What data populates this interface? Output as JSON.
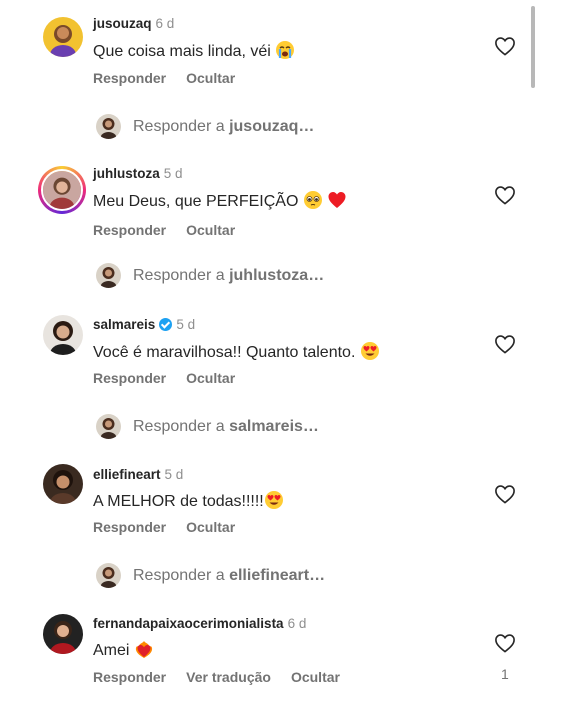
{
  "comments": [
    {
      "username": "jusouzaq",
      "time": "6 d",
      "text": "Que coisa mais linda, véi",
      "actions": [
        "Responder",
        "Ocultar"
      ],
      "reply_user": "jusouzaq…",
      "emoji": "crying-face"
    },
    {
      "username": "juhlustoza",
      "time": "5 d",
      "text": "Meu Deus, que PERFEIÇÃO",
      "actions": [
        "Responder",
        "Ocultar"
      ],
      "reply_user": "juhlustoza…",
      "emoji": "pleading-face-and-heart"
    },
    {
      "username": "salmareis",
      "time": "5 d",
      "text": "Você é maravilhosa!! Quanto talento.",
      "actions": [
        "Responder",
        "Ocultar"
      ],
      "reply_user": "salmareis…",
      "emoji": "heart-eyes",
      "verified": true
    },
    {
      "username": "elliefineart",
      "time": "5 d",
      "text": "A MELHOR de todas!!!!!",
      "actions": [
        "Responder",
        "Ocultar"
      ],
      "reply_user": "elliefineart…",
      "emoji": "heart-eyes"
    },
    {
      "username": "fernandapaixaocerimonialista",
      "time": "6 d",
      "text": "Amei",
      "actions": [
        "Responder",
        "Ver tradução",
        "Ocultar"
      ],
      "like_count": "1",
      "emoji": "heart-on-fire"
    }
  ],
  "reply_prefix": "Responder a",
  "colors": {
    "text": "#262626",
    "muted": "#737373",
    "heart_red": "#ed1c24",
    "verified": "#1da1f2"
  }
}
